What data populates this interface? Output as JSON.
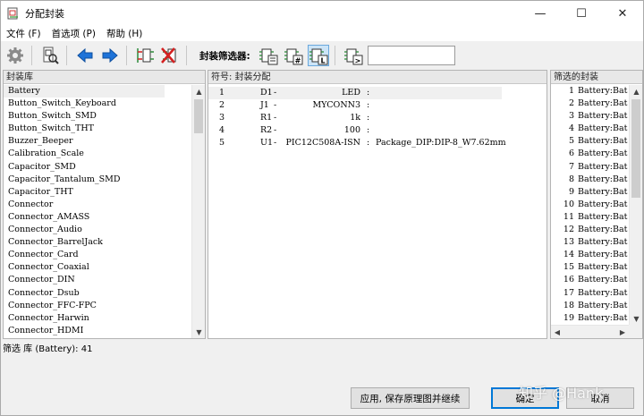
{
  "window": {
    "title": "分配封装",
    "controls": {
      "minimize": "—",
      "maximize": "☐",
      "close": "✕"
    }
  },
  "menu": [
    {
      "label": "文件 (F)"
    },
    {
      "label": "首选项 (P)"
    },
    {
      "label": "帮助 (H)"
    }
  ],
  "toolbar": {
    "filter_label": "封装筛选器:",
    "filter_input_value": "",
    "icons": [
      "gear-icon",
      "library-browser-icon",
      "arrow-left-icon",
      "arrow-right-icon",
      "auto-assign-icon",
      "delete-assignments-icon",
      "filter-keywords-icon",
      "filter-pincount-icon",
      "filter-library-icon",
      "filter-text-icon"
    ]
  },
  "library_panel": {
    "header": "封装库",
    "items": [
      "Battery",
      "Button_Switch_Keyboard",
      "Button_Switch_SMD",
      "Button_Switch_THT",
      "Buzzer_Beeper",
      "Calibration_Scale",
      "Capacitor_SMD",
      "Capacitor_Tantalum_SMD",
      "Capacitor_THT",
      "Connector",
      "Connector_AMASS",
      "Connector_Audio",
      "Connector_BarrelJack",
      "Connector_Card",
      "Connector_Coaxial",
      "Connector_DIN",
      "Connector_Dsub",
      "Connector_FFC-FPC",
      "Connector_Harwin",
      "Connector_HDMI"
    ],
    "selected_index": 0
  },
  "assign_panel": {
    "header": "符号: 封装分配",
    "rows": [
      {
        "index": "1",
        "ref": "D1",
        "dash": "-",
        "value": "LED",
        "sep": ":",
        "footprint": ""
      },
      {
        "index": "2",
        "ref": "J1",
        "dash": "-",
        "value": "MYCONN3",
        "sep": ":",
        "footprint": ""
      },
      {
        "index": "3",
        "ref": "R1",
        "dash": "-",
        "value": "1k",
        "sep": ":",
        "footprint": ""
      },
      {
        "index": "4",
        "ref": "R2",
        "dash": "-",
        "value": "100",
        "sep": ":",
        "footprint": ""
      },
      {
        "index": "5",
        "ref": "U1",
        "dash": "-",
        "value": "PIC12C508A-ISN",
        "sep": ":",
        "footprint": "Package_DIP:DIP-8_W7.62mm"
      }
    ]
  },
  "filtered_panel": {
    "header": "筛选的封装",
    "rows": [
      {
        "n": "1",
        "v": "Battery:Bat"
      },
      {
        "n": "2",
        "v": "Battery:Bat"
      },
      {
        "n": "3",
        "v": "Battery:Bat"
      },
      {
        "n": "4",
        "v": "Battery:Bat"
      },
      {
        "n": "5",
        "v": "Battery:Bat"
      },
      {
        "n": "6",
        "v": "Battery:Bat"
      },
      {
        "n": "7",
        "v": "Battery:Bat"
      },
      {
        "n": "8",
        "v": "Battery:Bat"
      },
      {
        "n": "9",
        "v": "Battery:Bat"
      },
      {
        "n": "10",
        "v": "Battery:Bat"
      },
      {
        "n": "11",
        "v": "Battery:Bat"
      },
      {
        "n": "12",
        "v": "Battery:Bat"
      },
      {
        "n": "13",
        "v": "Battery:Bat"
      },
      {
        "n": "14",
        "v": "Battery:Bat"
      },
      {
        "n": "15",
        "v": "Battery:Bat"
      },
      {
        "n": "16",
        "v": "Battery:Bat"
      },
      {
        "n": "17",
        "v": "Battery:Bat"
      },
      {
        "n": "18",
        "v": "Battery:Bat"
      },
      {
        "n": "19",
        "v": "Battery:Bat"
      }
    ]
  },
  "status": {
    "text": "筛选 库 (Battery): 41"
  },
  "buttons": {
    "apply_save": "应用, 保存原理图并继续",
    "ok": "确定",
    "cancel": "取消"
  },
  "watermark": "知乎 @Hank",
  "colors": {
    "accent": "#0078d7",
    "selection": "#cce4f7",
    "arrow_blue": "#1e73d8",
    "icon_green": "#2e8b3a",
    "icon_red": "#d42020"
  }
}
